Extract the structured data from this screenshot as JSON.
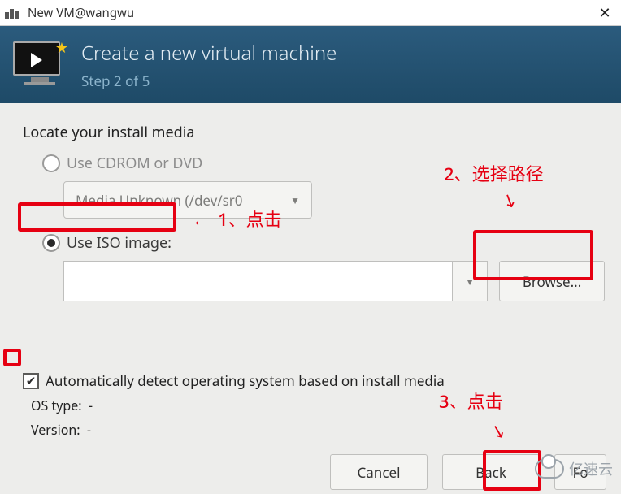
{
  "window": {
    "title": "New VM@wangwu"
  },
  "header": {
    "title": "Create a new virtual machine",
    "step": "Step 2 of 5"
  },
  "section": {
    "title": "Locate your install media"
  },
  "options": {
    "cdrom": {
      "label": "Use CDROM or DVD",
      "selected": false
    },
    "iso": {
      "label": "Use ISO image:",
      "selected": true
    }
  },
  "media_combo": {
    "value": "Media Unknown (/dev/sr0"
  },
  "iso_input": {
    "value": "",
    "placeholder": ""
  },
  "browse": {
    "label": "Browse..."
  },
  "autodetect": {
    "checked": true,
    "label": "Automatically detect operating system based on install media"
  },
  "osinfo": {
    "type_label": "OS type:",
    "type_value": "-",
    "version_label": "Version:",
    "version_value": "-"
  },
  "buttons": {
    "cancel": "Cancel",
    "back": "Back",
    "forward": "Fo"
  },
  "annotations": {
    "n1": "1)",
    "n2": "2)",
    "n3": "3)",
    "a1": "1、点击",
    "a2": "2、选择路径",
    "a3": "3、点击"
  },
  "watermark": {
    "text": "亿速云"
  }
}
